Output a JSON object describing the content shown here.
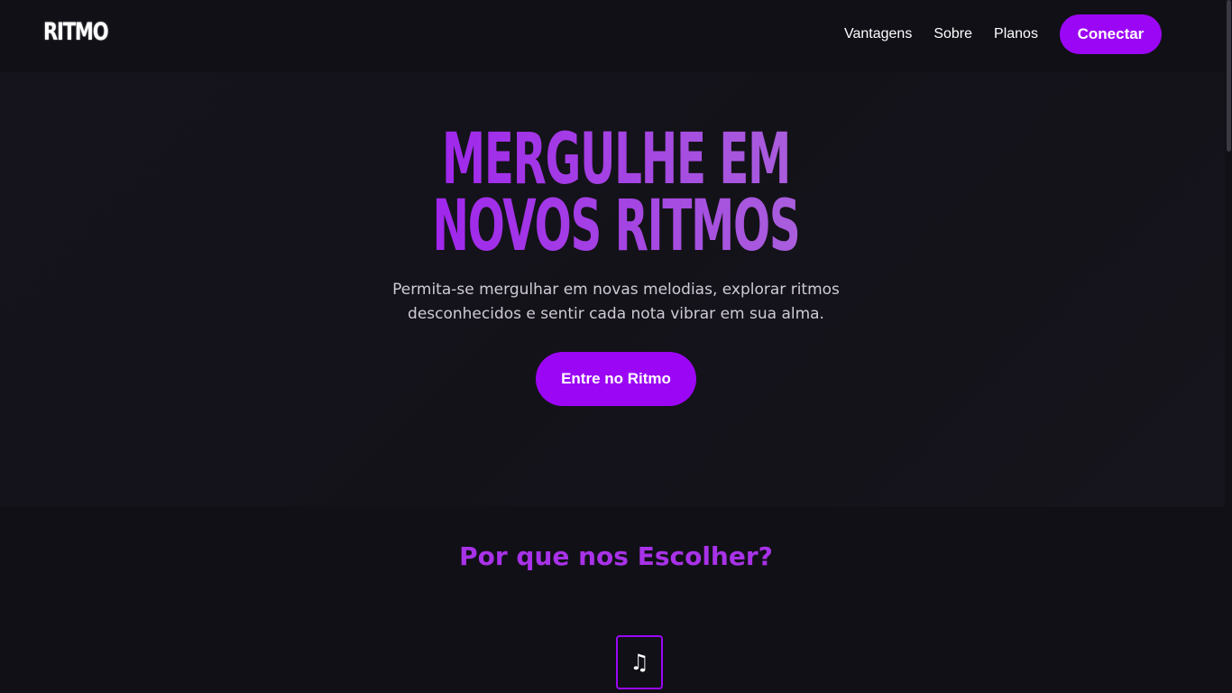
{
  "brand": {
    "logo": "RITMO",
    "accent_color": "#9b07f5"
  },
  "nav": {
    "links": [
      "Vantagens",
      "Sobre",
      "Planos"
    ],
    "cta_label": "Conectar"
  },
  "hero": {
    "title_line1": "MERGULHE EM",
    "title_line2": "NOVOS RITMOS",
    "subtitle_line1": "Permita-se mergulhar em novas melodias, explorar ritmos",
    "subtitle_line2": "desconhecidos e sentir cada nota vibrar em sua alma.",
    "cta_label": "Entre no Ritmo"
  },
  "features": {
    "title": "Por que nos Escolher?",
    "icon": "music-note-icon",
    "icon_glyph": "♫"
  }
}
